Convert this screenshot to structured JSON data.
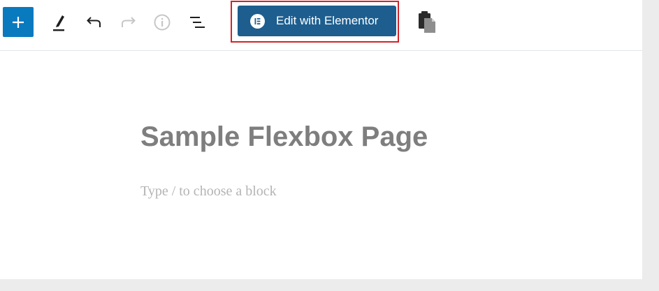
{
  "toolbar": {
    "inserter_icon": "plus-icon",
    "tools_icon": "pen-icon",
    "undo_icon": "undo-icon",
    "redo_icon": "redo-icon",
    "info_icon": "info-icon",
    "outline_icon": "list-view-icon",
    "elementor_button": {
      "label": "Edit with Elementor",
      "icon": "elementor-logo-icon",
      "bg_color": "#1d5e8f",
      "highlight_color": "#d2232a"
    },
    "clipboard_icon": "clipboard-icon",
    "accent_color": "#0a7abf"
  },
  "content": {
    "title": "Sample Flexbox Page",
    "placeholder": "Type / to choose a block"
  }
}
